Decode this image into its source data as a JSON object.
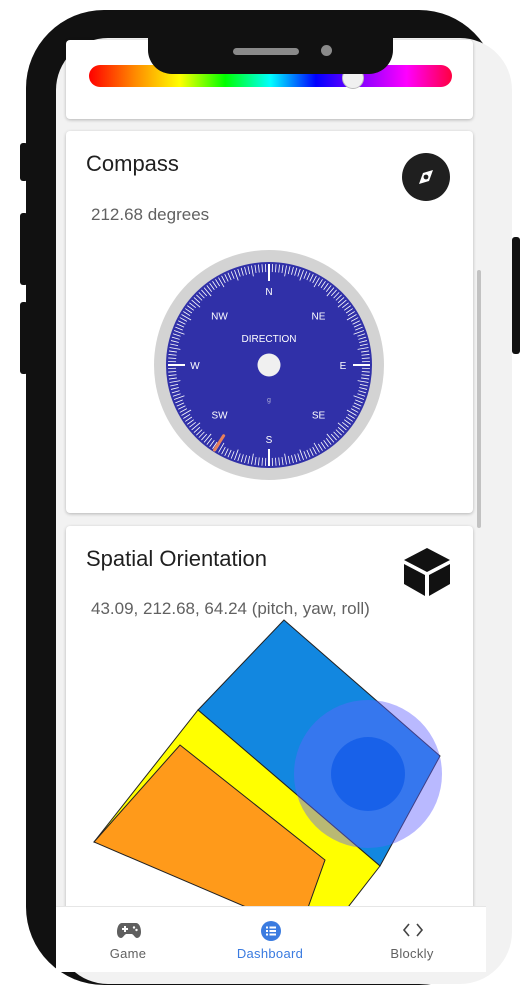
{
  "colors": {
    "accent": "#3a7be0",
    "compass_face": "#3030a8",
    "cube_blue": "#1287e0",
    "cube_yellow": "#ffff00",
    "cube_orange": "#ff9a1a"
  },
  "color_slider": {
    "value": 0.72
  },
  "compass": {
    "title": "Compass",
    "value": "212.68 degrees",
    "heading": 212.68,
    "dial": {
      "center_label": "DIRECTION",
      "small_label": "g",
      "directions": [
        "N",
        "NE",
        "E",
        "SE",
        "S",
        "SW",
        "W",
        "NW"
      ]
    },
    "icon": "compass-icon"
  },
  "orientation": {
    "title": "Spatial Orientation",
    "value": "43.09, 212.68, 64.24 (pitch, yaw, roll)",
    "pitch": 43.09,
    "yaw": 212.68,
    "roll": 64.24,
    "icon": "cube-icon"
  },
  "nav": {
    "items": [
      {
        "label": "Game",
        "icon": "gamepad-icon",
        "active": false
      },
      {
        "label": "Dashboard",
        "icon": "list-icon",
        "active": true
      },
      {
        "label": "Blockly",
        "icon": "code-icon",
        "active": false
      }
    ]
  }
}
